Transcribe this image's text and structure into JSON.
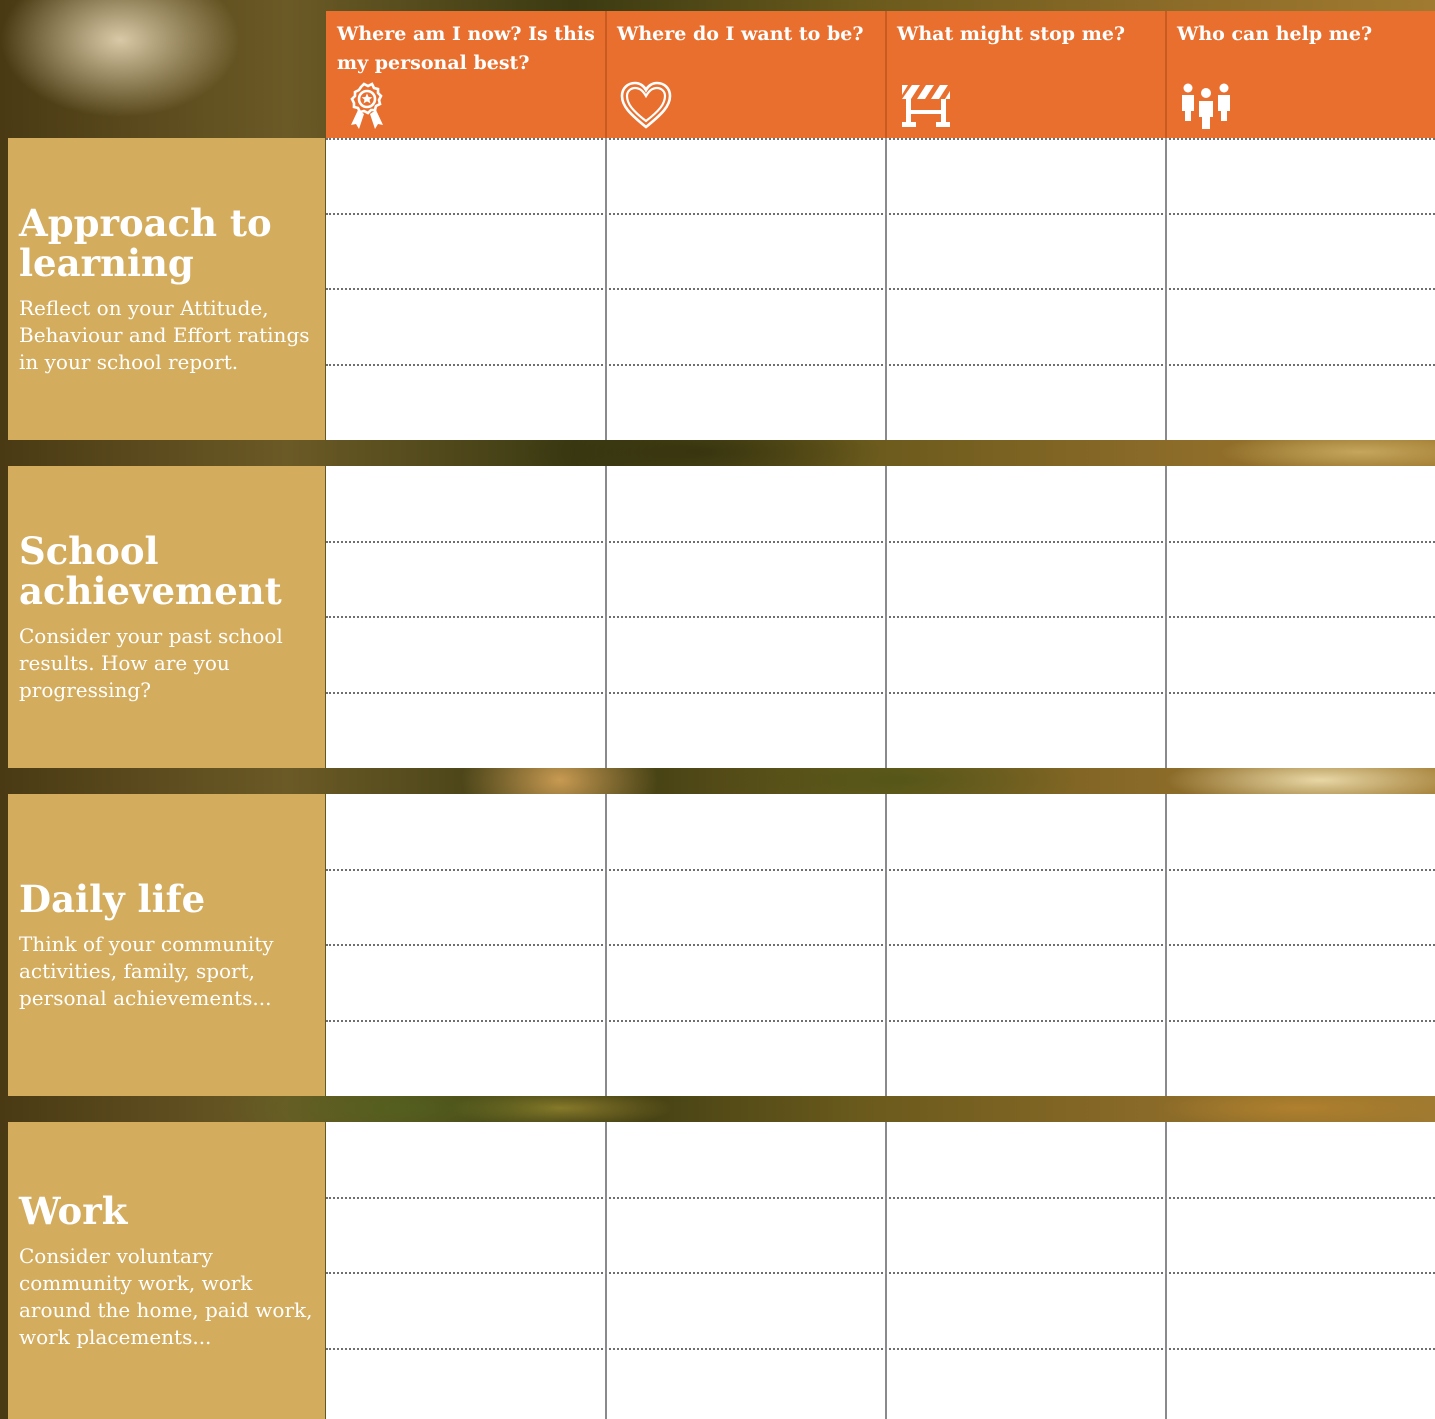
{
  "columns": [
    {
      "label": "Where am I now? Is this my personal best?",
      "icon": "award-ribbon-icon"
    },
    {
      "label": "Where do I want to be?",
      "icon": "heart-icon"
    },
    {
      "label": "What might stop me?",
      "icon": "barrier-icon"
    },
    {
      "label": "Who can help me?",
      "icon": "people-group-icon"
    }
  ],
  "sections": [
    {
      "title": "Approach to learning",
      "description": "Reflect on your Attitude, Behaviour and Effort ratings in your school report."
    },
    {
      "title": "School achievement",
      "description": "Consider your past school results. How are you progressing?"
    },
    {
      "title": "Daily life",
      "description": "Think of your community activities, family, sport, personal achievements..."
    },
    {
      "title": "Work",
      "description": "Consider voluntary community work, work around the home, paid work, work placements..."
    }
  ],
  "colors": {
    "header_orange": "#e96f2f",
    "section_gold": "#d4ac5e",
    "cell_white": "#ffffff",
    "divider_grey": "#8a8a8e"
  }
}
